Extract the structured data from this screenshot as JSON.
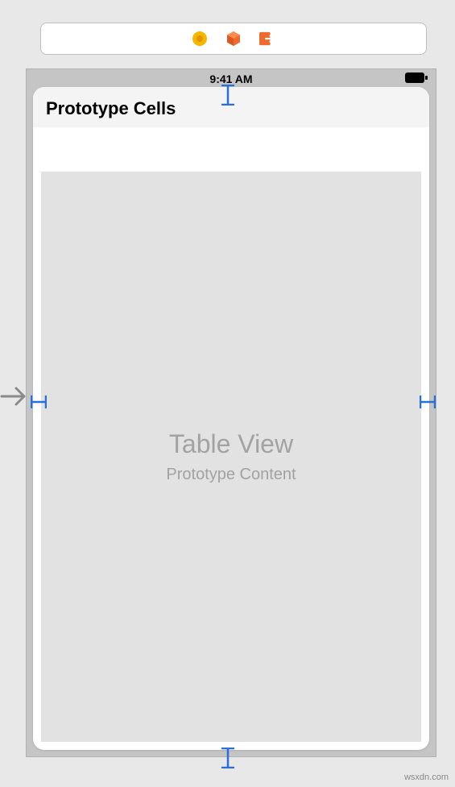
{
  "toolbar": {
    "icons": {
      "coin": "coin-icon",
      "cube": "cube-icon",
      "exit": "exit-icon"
    }
  },
  "statusBar": {
    "time": "9:41 AM"
  },
  "header": {
    "title": "Prototype Cells"
  },
  "tableView": {
    "title": "Table View",
    "subtitle": "Prototype Content"
  },
  "watermark": "wsxdn.com"
}
